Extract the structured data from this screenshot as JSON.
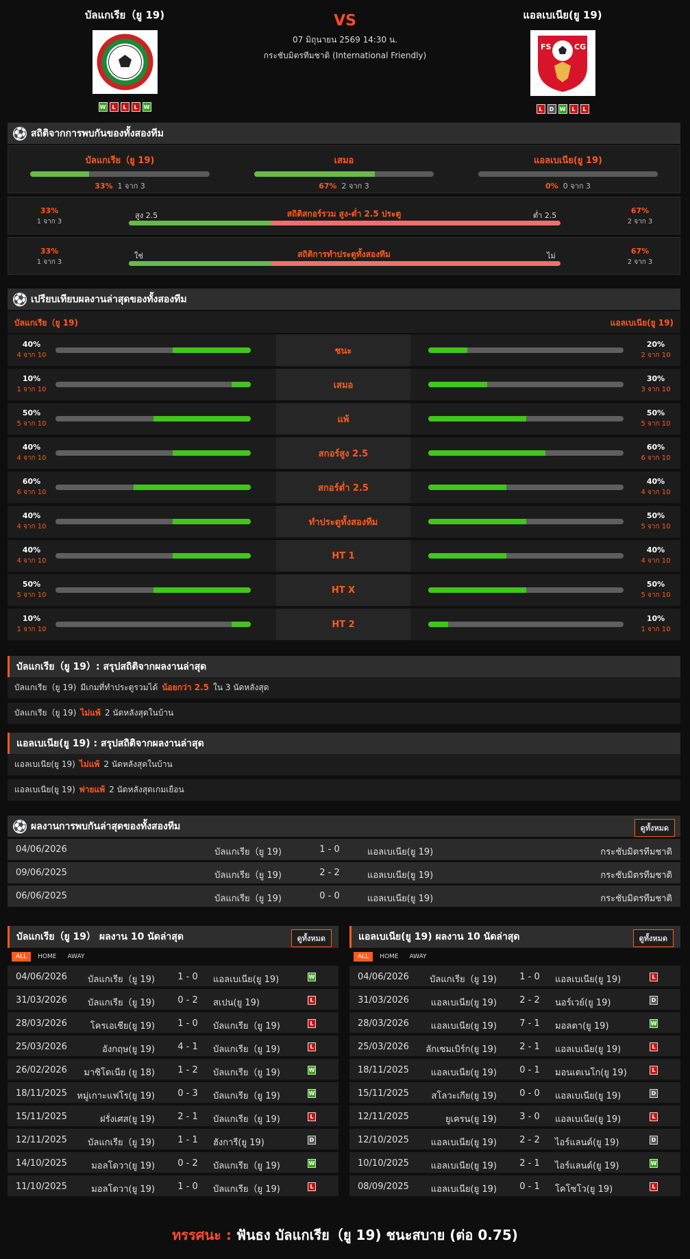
{
  "match": {
    "home": "บัลแกเรีย（ยู 19)",
    "away": "แอลเบเนีย(ยู 19)",
    "vs": "VS",
    "datetime": "07 มิถุนายน 2569 14:30 น.",
    "competition": "กระชับมิตรทีมชาติ (International Friendly)",
    "home_form": [
      "W",
      "L",
      "L",
      "L",
      "W"
    ],
    "away_form": [
      "L",
      "D",
      "W",
      "L",
      "L"
    ]
  },
  "h2h_stats": {
    "title": "สถิติจากการพบกันของทั้งสองทีม",
    "home": {
      "label": "บัลแกเรีย（ยู 19)",
      "pct": "33%",
      "count": "1 จาก 3",
      "value": 0.33
    },
    "draw": {
      "label": "เสมอ",
      "pct": "67%",
      "count": "2 จาก 3",
      "value": 0.67
    },
    "away": {
      "label": "แอลเบเนีย(ยู 19)",
      "pct": "0%",
      "count": "0 จาก 3",
      "value": 0
    },
    "goals": {
      "left_pct": "33%",
      "left_count": "1 จาก 3",
      "right_pct": "67%",
      "right_count": "2 จาก 3",
      "left_label": "สูง 2.5",
      "right_label": "ต่ำ 2.5",
      "title": "สถิติสกอร์รวม สูง-ต่ำ 2.5 ประตู",
      "value": 0.33
    },
    "btts": {
      "left_pct": "33%",
      "left_count": "1 จาก 3",
      "right_pct": "67%",
      "right_count": "2 จาก 3",
      "left_label": "ใช่",
      "right_label": "ไม่",
      "title": "สถิติการทำประตูทั้งสองทีม",
      "value": 0.33
    }
  },
  "compare": {
    "title": "เปรียบเทียบผลงานล่าสุดของทั้งสองทีม",
    "home": "บัลแกเรีย（ยู 19)",
    "away": "แอลเบเนีย(ยู 19)",
    "rows": [
      {
        "label": "ชนะ",
        "lp": "40%",
        "lc": "4 จาก 10",
        "lv": 0.4,
        "rp": "20%",
        "rc": "2 จาก 10",
        "rv": 0.2
      },
      {
        "label": "เสมอ",
        "lp": "10%",
        "lc": "1 จาก 10",
        "lv": 0.1,
        "rp": "30%",
        "rc": "3 จาก 10",
        "rv": 0.3
      },
      {
        "label": "แพ้",
        "lp": "50%",
        "lc": "5 จาก 10",
        "lv": 0.5,
        "rp": "50%",
        "rc": "5 จาก 10",
        "rv": 0.5
      },
      {
        "label": "สกอร์สูง 2.5",
        "lp": "40%",
        "lc": "4 จาก 10",
        "lv": 0.4,
        "rp": "60%",
        "rc": "6 จาก 10",
        "rv": 0.6
      },
      {
        "label": "สกอร์ต่ำ 2.5",
        "lp": "60%",
        "lc": "6 จาก 10",
        "lv": 0.6,
        "rp": "40%",
        "rc": "4 จาก 10",
        "rv": 0.4
      },
      {
        "label": "ทำประตูทั้งสองทีม",
        "lp": "40%",
        "lc": "4 จาก 10",
        "lv": 0.4,
        "rp": "50%",
        "rc": "5 จาก 10",
        "rv": 0.5
      },
      {
        "label": "HT 1",
        "lp": "40%",
        "lc": "4 จาก 10",
        "lv": 0.4,
        "rp": "40%",
        "rc": "4 จาก 10",
        "rv": 0.4
      },
      {
        "label": "HT X",
        "lp": "50%",
        "lc": "5 จาก 10",
        "lv": 0.5,
        "rp": "50%",
        "rc": "5 จาก 10",
        "rv": 0.5
      },
      {
        "label": "HT 2",
        "lp": "10%",
        "lc": "1 จาก 10",
        "lv": 0.1,
        "rp": "10%",
        "rc": "1 จาก 10",
        "rv": 0.1
      }
    ]
  },
  "summary_home": {
    "title": "บัลแกเรีย（ยู 19）: สรุปสถิติจากผลงานล่าสุด",
    "rows": [
      {
        "team": "บัลแกเรีย（ยู 19)",
        "pre": "มีเกมที่ทำประตูรวมได้",
        "hl": "น้อยกว่า  2.5",
        "post": "ใน 3 นัดหลังสุด"
      },
      {
        "team": "บัลแกเรีย（ยู 19)",
        "pre": "",
        "hl": "ไม่แพ้",
        "post": "2  นัดหลังสุดในบ้าน"
      }
    ]
  },
  "summary_away": {
    "title": "แอลเบเนีย(ยู 19) : สรุปสถิติจากผลงานล่าสุด",
    "rows": [
      {
        "team": "แอลเบเนีย(ยู 19)",
        "pre": "",
        "hl": "ไม่แพ้",
        "post": "2  นัดหลังสุดในบ้าน"
      },
      {
        "team": "แอลเบเนีย(ยู 19)",
        "pre": "",
        "hl": "พ่ายแพ้",
        "post": "2  นัดหลังสุดเกมเยือน"
      }
    ]
  },
  "h2h_results": {
    "title": "ผลงานการพบกันล่าสุดของทั้งสองทีม",
    "view_all": "ดูทั้งหมด",
    "rows": [
      {
        "date": "04/06/2026",
        "home": "บัลแกเรีย（ยู 19)",
        "score": "1 - 0",
        "away": "แอลเบเนีย(ยู 19)",
        "comp": "กระชับมิตรทีมชาติ"
      },
      {
        "date": "09/06/2025",
        "home": "บัลแกเรีย（ยู 19)",
        "score": "2 - 2",
        "away": "แอลเบเนีย(ยู 19)",
        "comp": "กระชับมิตรทีมชาติ"
      },
      {
        "date": "06/06/2025",
        "home": "บัลแกเรีย（ยู 19)",
        "score": "0 - 0",
        "away": "แอลเบเนีย(ยู 19)",
        "comp": "กระชับมิตรทีมชาติ"
      }
    ]
  },
  "last10_home": {
    "title": "บัลแกเรีย（ยู 19）  ผลงาน 10 นัดล่าสุด",
    "view_all": "ดูทั้งหมด",
    "tabs": [
      "ALL",
      "HOME",
      "AWAY"
    ],
    "rows": [
      {
        "date": "04/06/2026",
        "home": "บัลแกเรีย（ยู 19)",
        "score": "1 - 0",
        "away": "แอลเบเนีย(ยู 19)",
        "res": "W"
      },
      {
        "date": "31/03/2026",
        "home": "บัลแกเรีย（ยู 19)",
        "score": "0 - 2",
        "away": "สเปน(ยู 19)",
        "res": "L"
      },
      {
        "date": "28/03/2026",
        "home": "โครเอเชีย(ยู 19)",
        "score": "1 - 0",
        "away": "บัลแกเรีย（ยู 19)",
        "res": "L"
      },
      {
        "date": "25/03/2026",
        "home": "อังกฤษ(ยู 19)",
        "score": "4 - 1",
        "away": "บัลแกเรีย（ยู 19)",
        "res": "L"
      },
      {
        "date": "26/02/2026",
        "home": "มาซิโดเนีย (ยู 18)",
        "score": "1 - 2",
        "away": "บัลแกเรีย（ยู 19)",
        "res": "W"
      },
      {
        "date": "18/11/2025",
        "home": "หมู่เกาะแฟโร(ยู 19)",
        "score": "0 - 3",
        "away": "บัลแกเรีย（ยู 19)",
        "res": "W"
      },
      {
        "date": "15/11/2025",
        "home": "ฝรั่งเศส(ยู 19)",
        "score": "2 - 1",
        "away": "บัลแกเรีย（ยู 19)",
        "res": "L"
      },
      {
        "date": "12/11/2025",
        "home": "บัลแกเรีย（ยู 19)",
        "score": "1 - 1",
        "away": "ฮังการี(ยู 19)",
        "res": "D"
      },
      {
        "date": "14/10/2025",
        "home": "มอลโดวา(ยู 19)",
        "score": "0 - 2",
        "away": "บัลแกเรีย（ยู 19)",
        "res": "W"
      },
      {
        "date": "11/10/2025",
        "home": "มอลโดวา(ยู 19)",
        "score": "1 - 0",
        "away": "บัลแกเรีย（ยู 19)",
        "res": "L"
      }
    ]
  },
  "last10_away": {
    "title": "แอลเบเนีย(ยู 19) ผลงาน 10 นัดล่าสุด",
    "view_all": "ดูทั้งหมด",
    "tabs": [
      "ALL",
      "HOME",
      "AWAY"
    ],
    "rows": [
      {
        "date": "04/06/2026",
        "home": "บัลแกเรีย（ยู 19)",
        "score": "1 - 0",
        "away": "แอลเบเนีย(ยู 19)",
        "res": "L"
      },
      {
        "date": "31/03/2026",
        "home": "แอลเบเนีย(ยู 19)",
        "score": "2 - 2",
        "away": "นอร์เวย์(ยู 19)",
        "res": "D"
      },
      {
        "date": "28/03/2026",
        "home": "แอลเบเนีย(ยู 19)",
        "score": "7 - 1",
        "away": "มอลตา(ยู 19)",
        "res": "W"
      },
      {
        "date": "25/03/2026",
        "home": "ลักเซมเบิร์ก(ยู 19)",
        "score": "2 - 1",
        "away": "แอลเบเนีย(ยู 19)",
        "res": "L"
      },
      {
        "date": "18/11/2025",
        "home": "แอลเบเนีย(ยู 19)",
        "score": "0 - 1",
        "away": "มอนเตเนโก(ยู 19)",
        "res": "L"
      },
      {
        "date": "15/11/2025",
        "home": "สโลวะเกีย(ยู 19)",
        "score": "0 - 0",
        "away": "แอลเบเนีย(ยู 19)",
        "res": "D"
      },
      {
        "date": "12/11/2025",
        "home": "ยูเครน(ยู 19)",
        "score": "3 - 0",
        "away": "แอลเบเนีย(ยู 19)",
        "res": "L"
      },
      {
        "date": "12/10/2025",
        "home": "แอลเบเนีย(ยู 19)",
        "score": "2 - 2",
        "away": "ไอร์แลนด์(ยู 19)",
        "res": "D"
      },
      {
        "date": "10/10/2025",
        "home": "แอลเบเนีย(ยู 19)",
        "score": "2 - 1",
        "away": "ไอร์แลนด์(ยู 19)",
        "res": "W"
      },
      {
        "date": "08/09/2025",
        "home": "แอลเบเนีย(ยู 19)",
        "score": "0 - 1",
        "away": "โคโซโว(ยู 19)",
        "res": "L"
      }
    ]
  },
  "prediction": {
    "label": "ทรรศนะ :",
    "text": "ฟันธง บัลแกเรีย（ยู 19)  ชนะสบาย (ต่อ 0.75)"
  }
}
